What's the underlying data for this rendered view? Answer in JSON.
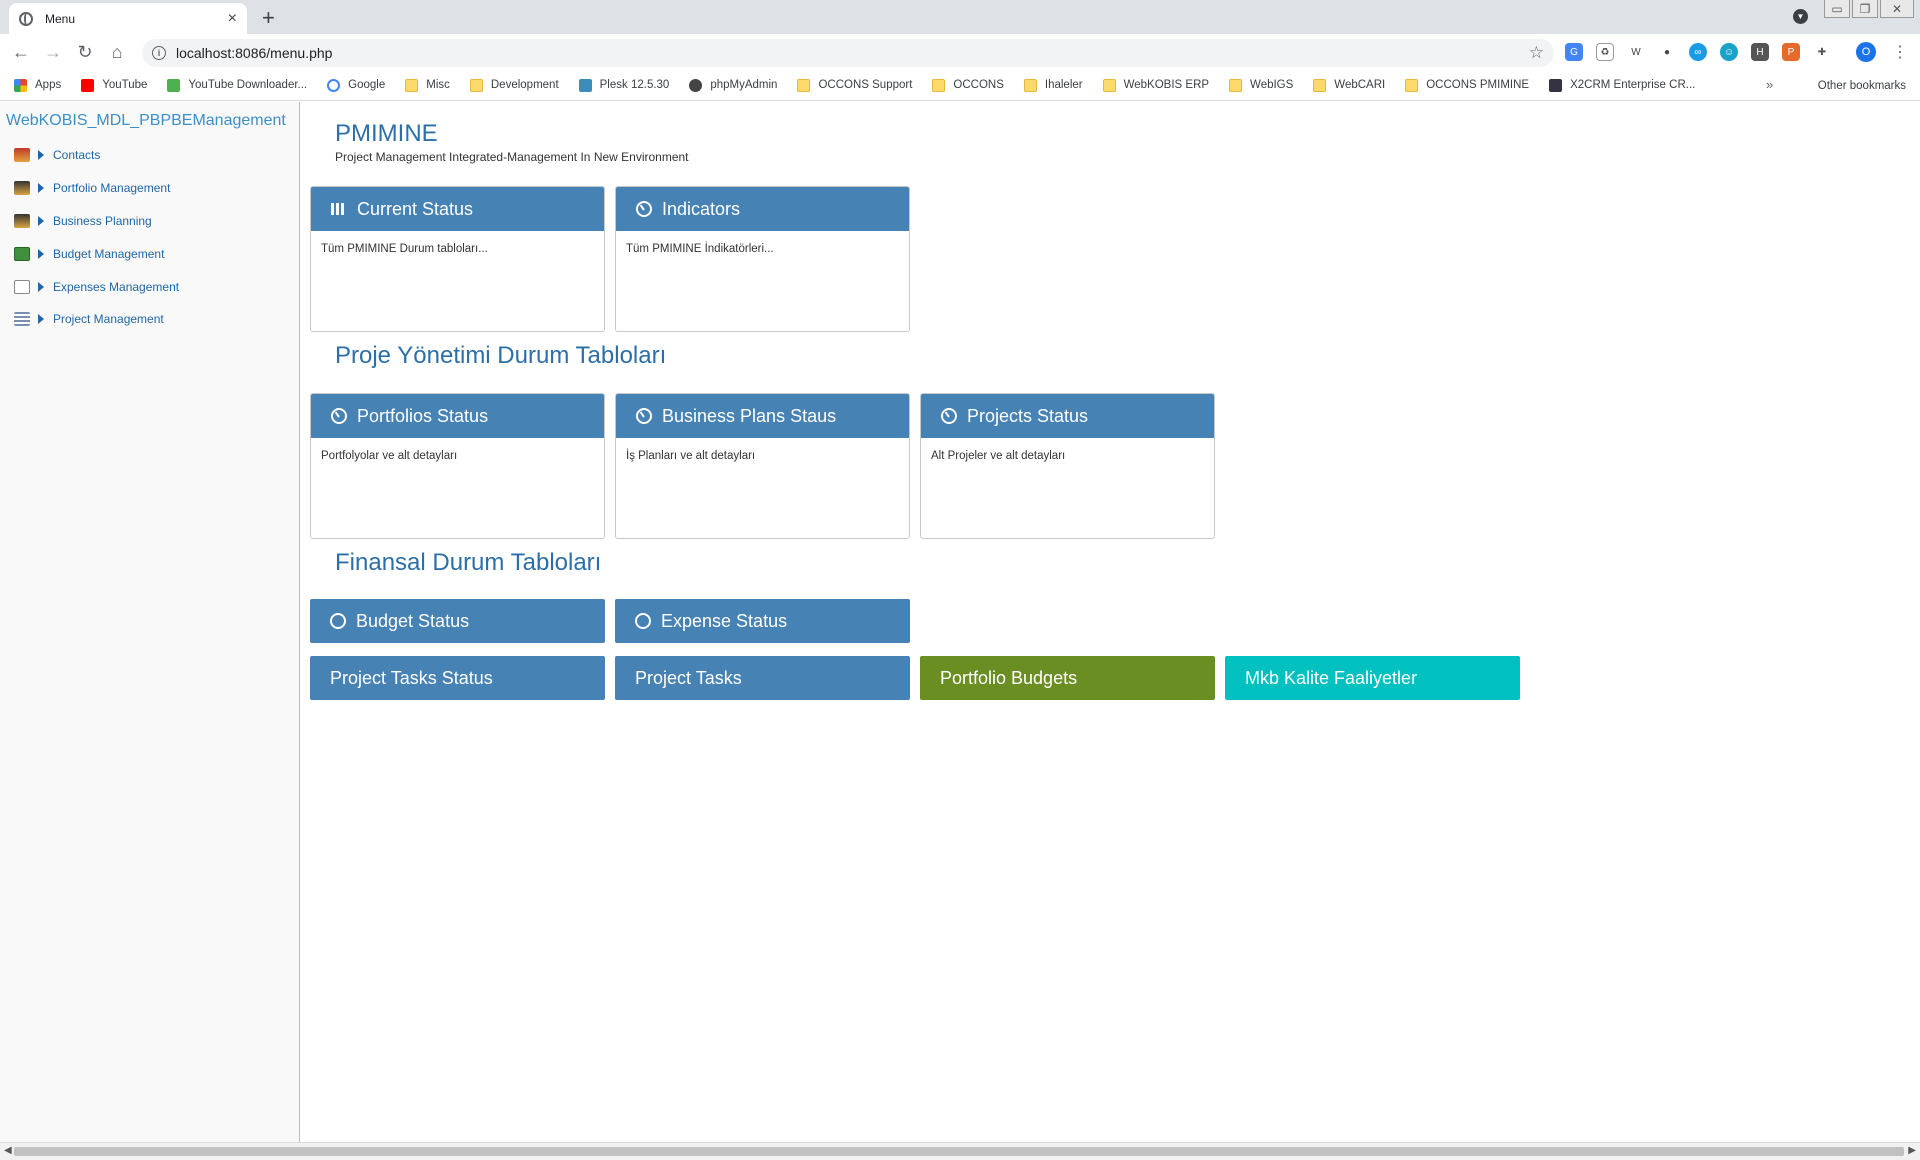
{
  "browser": {
    "tab_title": "Menu",
    "tab_close": "×",
    "new_tab": "+",
    "url": "localhost:8086/menu.php",
    "bookmarks": [
      {
        "label": "Apps",
        "icon": "apps-grid-icon"
      },
      {
        "label": "YouTube",
        "icon": "youtube-icon"
      },
      {
        "label": "YouTube Downloader...",
        "icon": "download-arrow-icon"
      },
      {
        "label": "Google",
        "icon": "google-icon"
      },
      {
        "label": "Misc",
        "icon": "folder-icon"
      },
      {
        "label": "Development",
        "icon": "folder-icon"
      },
      {
        "label": "Plesk 12.5.30",
        "icon": "plesk-icon"
      },
      {
        "label": "phpMyAdmin",
        "icon": "globe-icon"
      },
      {
        "label": "OCCONS Support",
        "icon": "folder-icon"
      },
      {
        "label": "OCCONS",
        "icon": "folder-icon"
      },
      {
        "label": "Ihaleler",
        "icon": "folder-icon"
      },
      {
        "label": "WebKOBIS ERP",
        "icon": "folder-icon"
      },
      {
        "label": "WebIGS",
        "icon": "folder-icon"
      },
      {
        "label": "WebCARI",
        "icon": "folder-icon"
      },
      {
        "label": "OCCONS PMIMINE",
        "icon": "folder-icon"
      },
      {
        "label": "X2CRM Enterprise CR...",
        "icon": "x2crm-icon"
      }
    ],
    "bookmarks_more": "»",
    "other_bookmarks": "Other bookmarks",
    "profile_initial": "O"
  },
  "sidebar": {
    "title": "WebKOBIS_MDL_PBPBEManagement",
    "items": [
      {
        "label": "Contacts",
        "icon": "contacts-icon"
      },
      {
        "label": "Portfolio Management",
        "icon": "portfolio-icon"
      },
      {
        "label": "Business Planning",
        "icon": "business-planning-icon"
      },
      {
        "label": "Budget Management",
        "icon": "budget-icon"
      },
      {
        "label": "Expenses Management",
        "icon": "expenses-icon"
      },
      {
        "label": "Project Management",
        "icon": "project-icon"
      }
    ]
  },
  "main": {
    "title": "PMIMINE",
    "subtitle": "Project Management Integrated-Management In New Environment",
    "section1": {
      "panels": [
        {
          "title": "Current Status",
          "desc": "Tüm PMIMINE Durum tabloları..."
        },
        {
          "title": "Indicators",
          "desc": "Tüm PMIMINE İndikatörleri..."
        }
      ]
    },
    "section2": {
      "heading": "Proje Yönetimi Durum Tabloları",
      "panels": [
        {
          "title": "Portfolios Status",
          "desc": "Portfolyolar ve alt detayları"
        },
        {
          "title": "Business Plans Staus",
          "desc": "İş Planları ve alt detayları"
        },
        {
          "title": "Projects Status",
          "desc": "Alt Projeler ve alt detayları"
        }
      ]
    },
    "section3": {
      "heading": "Finansal Durum Tabloları",
      "tiles": [
        {
          "title": "Budget Status"
        },
        {
          "title": "Expense Status"
        }
      ],
      "buttons": [
        {
          "title": "Project Tasks Status",
          "color": "#4682b4"
        },
        {
          "title": "Project Tasks",
          "color": "#4682b4"
        },
        {
          "title": "Portfolio Budgets",
          "color": "#6b8e23"
        },
        {
          "title": "Mkb Kalite Faaliyetler",
          "color": "#00c0c0"
        }
      ]
    }
  },
  "colors": {
    "panel_header": "#4682b4",
    "heading": "#2c6fa8",
    "link": "#1e66a5"
  }
}
